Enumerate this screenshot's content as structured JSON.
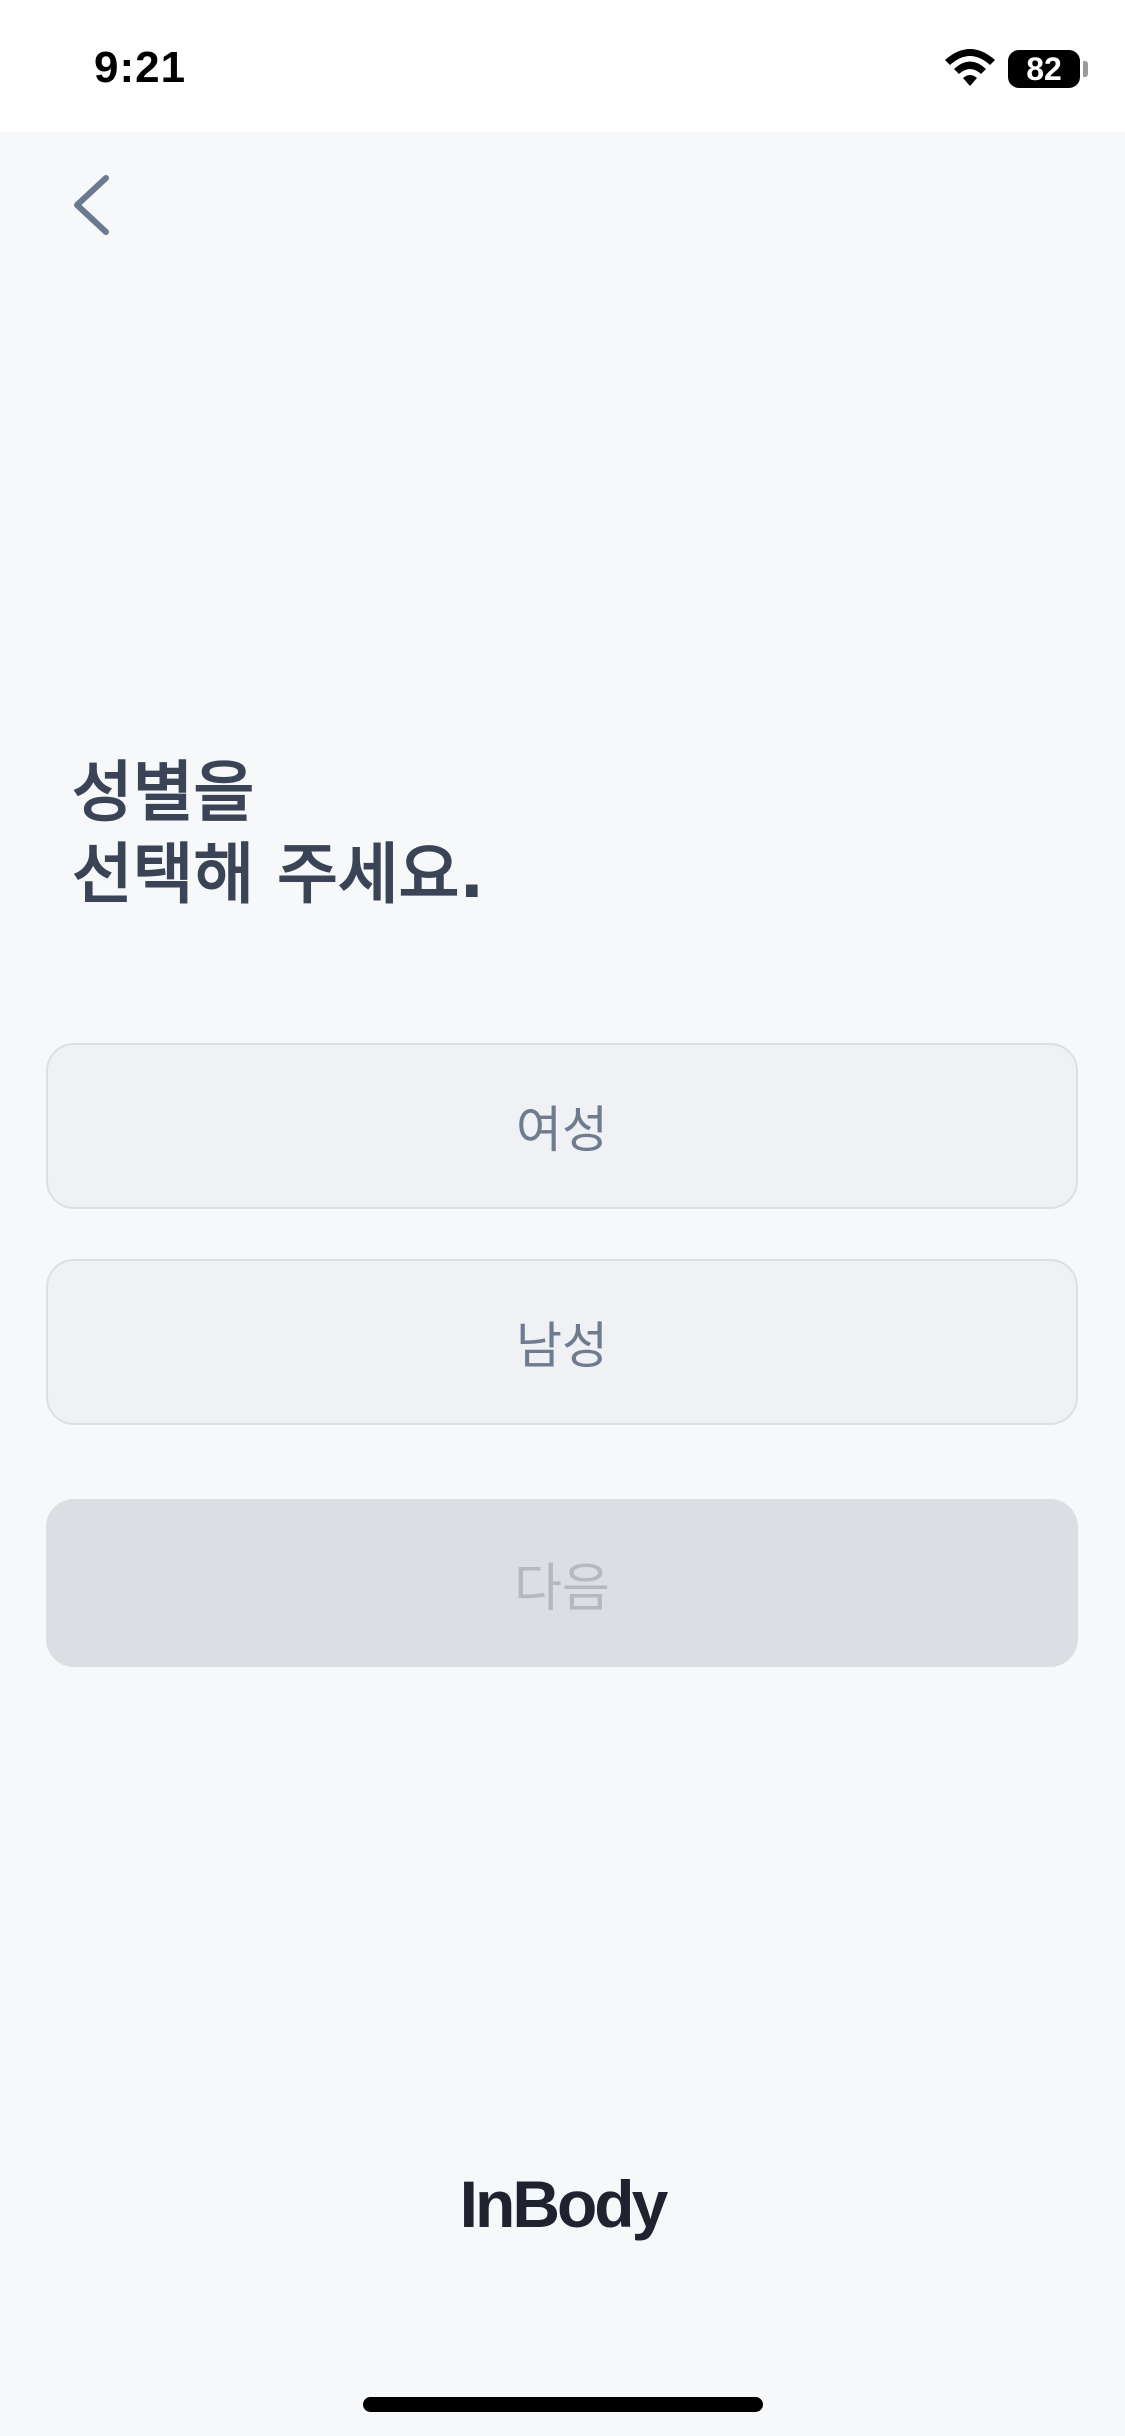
{
  "status_bar": {
    "time": "9:21",
    "battery_level": "82",
    "icons": [
      "wifi-icon",
      "battery-icon"
    ]
  },
  "nav": {
    "back_icon": "chevron-left-icon"
  },
  "title": "성별을\n선택해 주세요.",
  "options": [
    {
      "label": "여성",
      "selected": false
    },
    {
      "label": "남성",
      "selected": false
    }
  ],
  "next_button": {
    "label": "다음",
    "enabled": false
  },
  "brand": {
    "logo_text": "InBody"
  },
  "colors": {
    "background": "#f7f8fa",
    "title_text": "#3b4456",
    "option_bg": "#eff1f4",
    "option_border": "#dcdfe4",
    "option_text": "#6f7b8f",
    "disabled_bg": "#dbdee2",
    "disabled_text": "#b4b9c1",
    "back_icon": "#6b7a90"
  }
}
